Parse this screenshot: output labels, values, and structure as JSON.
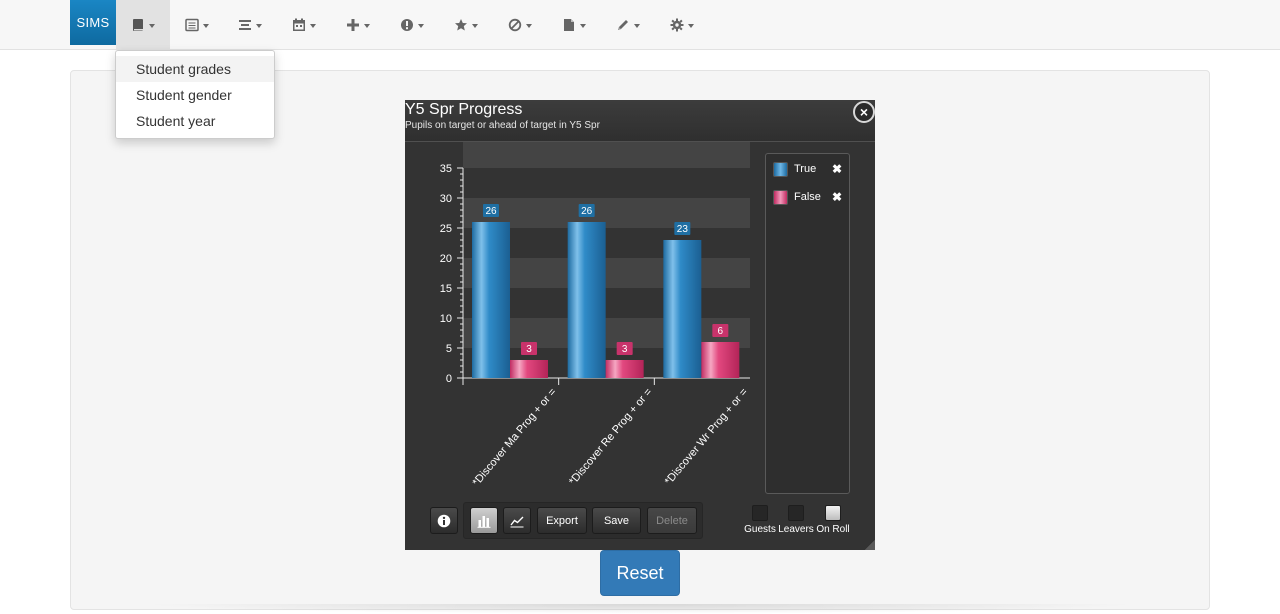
{
  "navbar": {
    "brand": "SIMS",
    "items": [
      {
        "icon": "book-icon"
      },
      {
        "icon": "list-alt-icon"
      },
      {
        "icon": "align-center-icon"
      },
      {
        "icon": "calendar-icon"
      },
      {
        "icon": "plus-icon"
      },
      {
        "icon": "exclamation-circle-icon"
      },
      {
        "icon": "star-icon"
      },
      {
        "icon": "ban-icon"
      },
      {
        "icon": "file-icon"
      },
      {
        "icon": "pencil-icon"
      },
      {
        "icon": "cog-icon"
      }
    ]
  },
  "dropdown": {
    "items": [
      "Student grades",
      "Student gender",
      "Student year"
    ]
  },
  "widget": {
    "title": "Y5 Spr Progress",
    "subtitle": "Pupils on target or ahead of target in Y5 Spr",
    "close_label": "×",
    "legend": [
      {
        "label": "True",
        "remove": "✖"
      },
      {
        "label": "False",
        "remove": "✖"
      }
    ],
    "toolbar": {
      "info_icon": "info-icon",
      "bar_chart_icon": "bar-chart-icon",
      "line_chart_icon": "line-chart-icon",
      "export": "Export",
      "save": "Save",
      "delete": "Delete"
    },
    "filters": [
      {
        "label": "Guests",
        "checked": false
      },
      {
        "label": "Leavers",
        "checked": false
      },
      {
        "label": "On Roll",
        "checked": true
      }
    ]
  },
  "reset_label": "Reset",
  "colors": {
    "brand": "#1a86c4",
    "true_series": "#2a7fb8",
    "false_series": "#e0457b",
    "primary_button": "#337ab7"
  },
  "chart_data": {
    "type": "bar",
    "title": "Y5 Spr Progress",
    "subtitle": "Pupils on target or ahead of target in Y5 Spr",
    "categories": [
      "*Discover Ma Prog + or =",
      "*Discover Re Prog + or =",
      "*Discover Wr Prog + or ="
    ],
    "series": [
      {
        "name": "True",
        "values": [
          26,
          26,
          23
        ]
      },
      {
        "name": "False",
        "values": [
          3,
          3,
          6
        ]
      }
    ],
    "ylim": [
      0,
      35
    ],
    "yticks": [
      0,
      5,
      10,
      15,
      20,
      25,
      30,
      35
    ],
    "xlabel": "",
    "ylabel": "",
    "legend_position": "right",
    "data_labels": true
  }
}
